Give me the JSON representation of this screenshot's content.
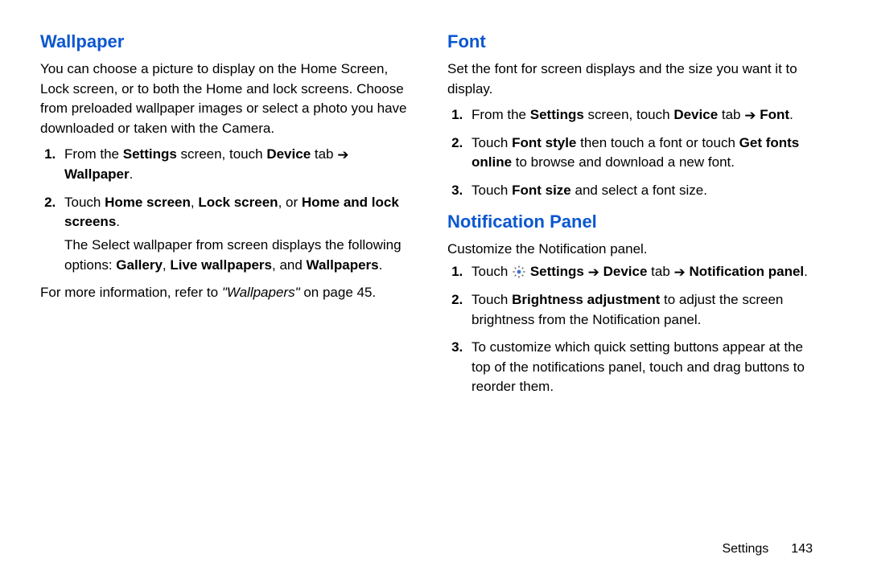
{
  "arrow": "➔",
  "left": {
    "heading_wall": "Wallpaper",
    "wall_intro": "You can choose a picture to display on the Home Screen, Lock screen, or to both the Home and lock screens. Choose from preloaded wallpaper images or select a photo you have downloaded or taken with the Camera.",
    "wall_s1_a": "From the ",
    "wall_s1_b": "Settings",
    "wall_s1_c": " screen, touch ",
    "wall_s1_d": "Device",
    "wall_s1_e": " tab ",
    "wall_s1_f": "Wallpaper",
    "wall_s1_g": ".",
    "wall_s2_a": "Touch ",
    "wall_s2_b": "Home screen",
    "wall_s2_c": ", ",
    "wall_s2_d": "Lock screen",
    "wall_s2_e": ", or ",
    "wall_s2_f": "Home and lock screens",
    "wall_s2_g": ".",
    "wall_s2_sub_a": "The Select wallpaper from screen displays the following options: ",
    "wall_s2_sub_b": "Gallery",
    "wall_s2_sub_c": ", ",
    "wall_s2_sub_d": "Live wallpapers",
    "wall_s2_sub_e": ", and ",
    "wall_s2_sub_f": "Wallpapers",
    "wall_s2_sub_g": ".",
    "wall_ref_a": "For more information, refer to ",
    "wall_ref_b": "\"Wallpapers\"",
    "wall_ref_c": " on page 45."
  },
  "right": {
    "heading_font": "Font",
    "font_intro": "Set the font for screen displays and the size you want it to display.",
    "font_s1_a": "From the ",
    "font_s1_b": "Settings",
    "font_s1_c": " screen, touch ",
    "font_s1_d": "Device",
    "font_s1_e": " tab ",
    "font_s1_f": "Font",
    "font_s1_g": ".",
    "font_s2_a": "Touch ",
    "font_s2_b": "Font style",
    "font_s2_c": " then touch a font or touch ",
    "font_s2_d": "Get fonts online",
    "font_s2_e": " to browse and download a new font.",
    "font_s3_a": "Touch ",
    "font_s3_b": "Font size",
    "font_s3_c": " and select a font size.",
    "heading_np": "Notification Panel",
    "np_intro": "Customize the Notification panel.",
    "np_s1_a": "Touch ",
    "np_s1_b": "Settings",
    "np_s1_c": " ",
    "np_s1_d": "Device",
    "np_s1_e": " tab ",
    "np_s1_f": "Notification panel",
    "np_s1_g": ".",
    "np_s2_a": "Touch ",
    "np_s2_b": "Brightness adjustment",
    "np_s2_c": " to adjust the screen brightness from the Notification panel.",
    "np_s3": "To customize which quick setting buttons appear at the top of the notifications panel, touch and drag buttons to reorder them."
  },
  "footer": {
    "label": "Settings",
    "page": "143"
  }
}
